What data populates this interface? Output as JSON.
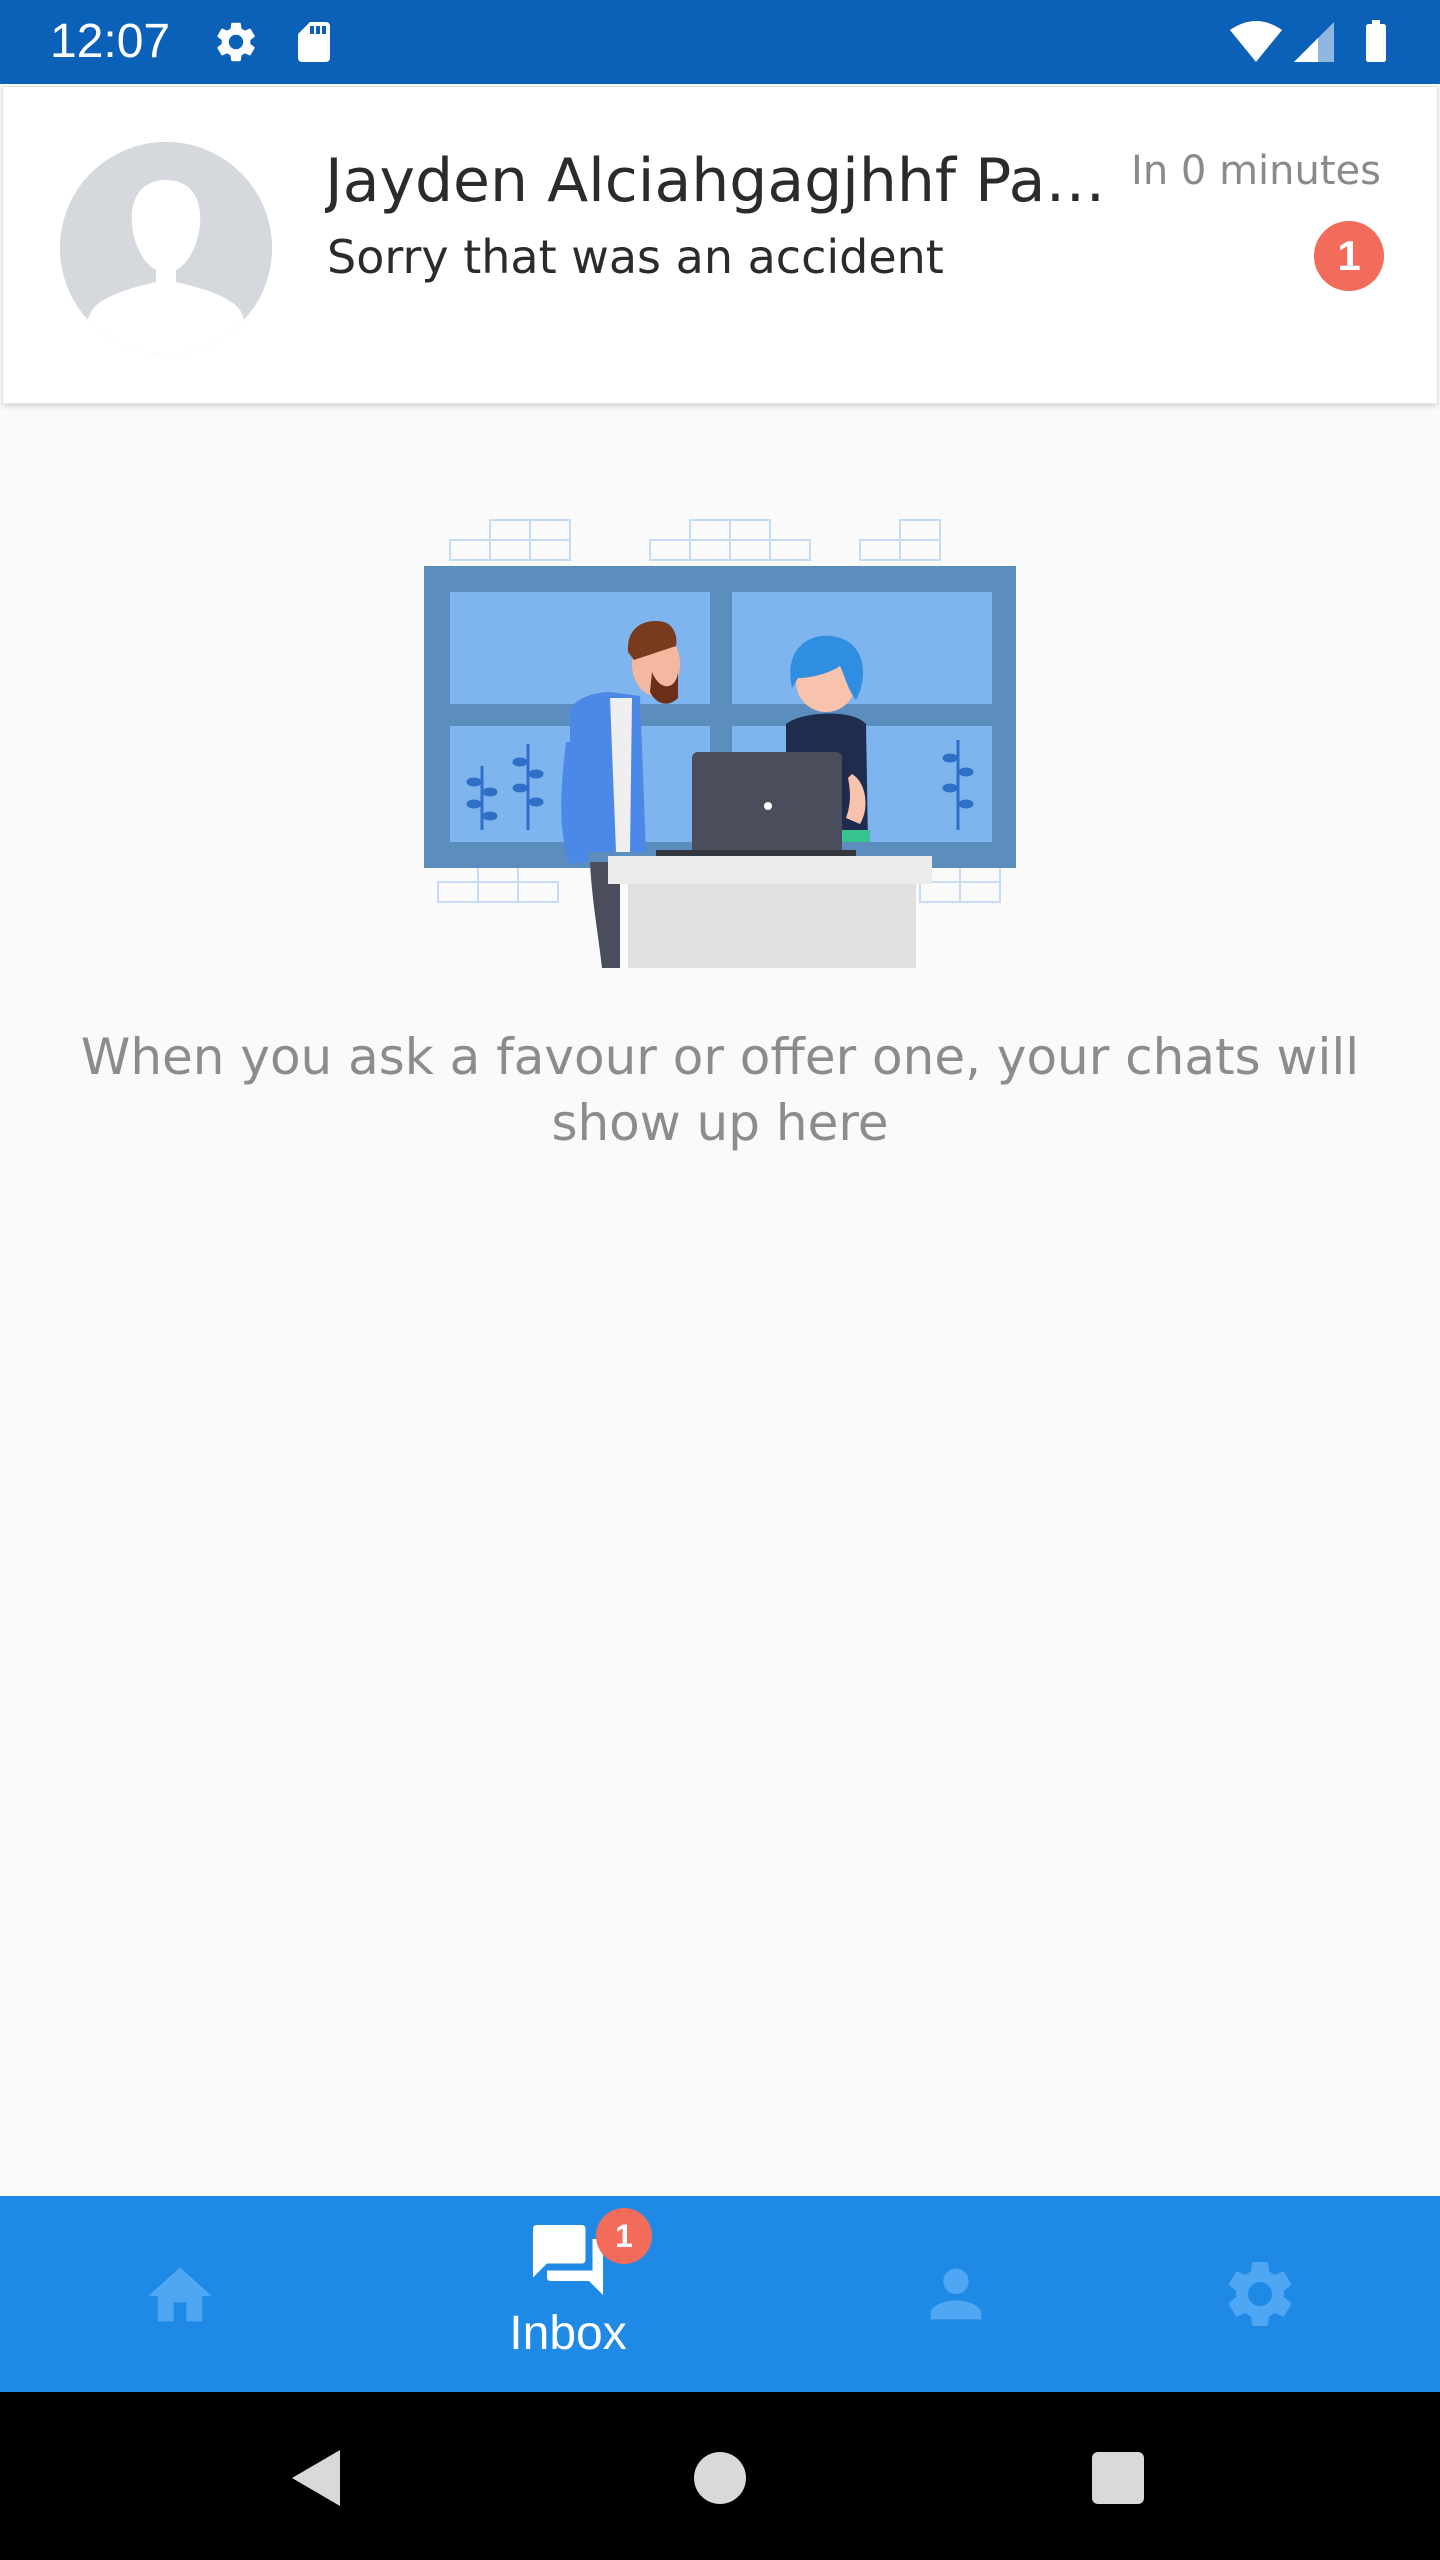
{
  "status_bar": {
    "time": "12:07",
    "left_icons": [
      "gear-icon",
      "sd-card-icon"
    ],
    "right_icons": [
      "wifi-icon",
      "cell-signal-icon",
      "battery-icon"
    ],
    "background": "#0b61b8"
  },
  "chat": {
    "name": "Jayden Alciahgagjhhf Pan...",
    "preview": "Sorry that was an accident",
    "time": "In 0 minutes",
    "unread_count": "1",
    "avatar": "default-user-avatar",
    "badge_color": "#f26b5b"
  },
  "empty_state": {
    "illustration": "people-at-laptop-illustration",
    "message": "When you ask a favour or offer one, your chats will show up here"
  },
  "bottom_nav": {
    "background": "#1f8ae6",
    "items": [
      {
        "icon": "home-icon",
        "label": "",
        "active": false
      },
      {
        "icon": "chat-bubbles-icon",
        "label": "Inbox",
        "active": true,
        "badge": "1"
      },
      {
        "icon": "person-icon",
        "label": "",
        "active": false
      },
      {
        "icon": "settings-gear-icon",
        "label": "",
        "active": false
      }
    ]
  },
  "system_nav": {
    "buttons": [
      "back-icon",
      "home-circle-icon",
      "recents-icon"
    ]
  }
}
